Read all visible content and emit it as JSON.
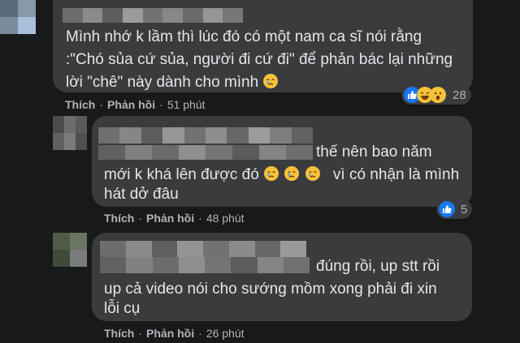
{
  "comments": [
    {
      "text_lines": [
        "Mình nhớ k lầm thì lúc đó có một nam ca sĩ nói rằng",
        ":\"Chó sủa cứ sủa, người đi cứ đi\" để phản bác lại những",
        "lời \"chê\" này dành cho mình"
      ],
      "inline_emoji": "crying-face",
      "like_label": "Thích",
      "reply_label": "Phản hồi",
      "timestamp": "51 phút",
      "reactions": [
        "like",
        "haha",
        "wow"
      ],
      "reaction_count": "28"
    },
    {
      "text_lines": [
        "thế nên bao năm",
        "mới k khá lên được đó",
        "vì có nhận là mình",
        "hát dở đâu"
      ],
      "inline_emoji": "crying-face",
      "like_label": "Thích",
      "reply_label": "Phản hồi",
      "timestamp": "48 phút",
      "reactions": [
        "like"
      ],
      "reaction_count": "5"
    },
    {
      "text_lines": [
        "đúng rồi, up stt rồi",
        "up cả video nói cho sướng mồm xong phải đi xin",
        "lỗi cụ"
      ],
      "like_label": "Thích",
      "reply_label": "Phản hồi",
      "timestamp": "26 phút"
    }
  ],
  "colors": {
    "page_bg": "#18191a",
    "bubble_bg": "#3a3b3c",
    "text": "#e4e6eb",
    "meta_text": "#b0b3b8",
    "like_blue": "#1877f2"
  },
  "separator": "·"
}
